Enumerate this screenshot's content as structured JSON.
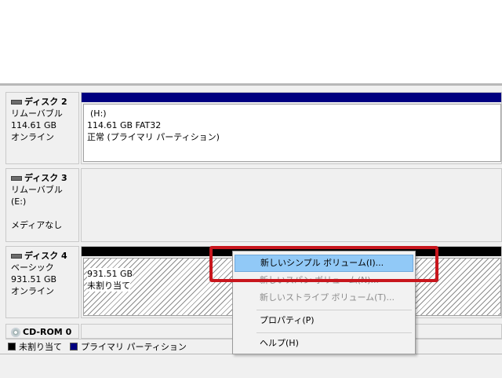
{
  "disks": [
    {
      "name": "ディスク 2",
      "type": "リムーバブル",
      "size": "114.61 GB",
      "status": "オンライン",
      "volume": {
        "letter": "(H:)",
        "size_fs": "114.61 GB FAT32",
        "state": "正常 (プライマリ パーティション)",
        "bar_color": "#000080"
      }
    },
    {
      "name": "ディスク 3",
      "type": "リムーバブル (E:)",
      "media": "メディアなし"
    },
    {
      "name": "ディスク 4",
      "type": "ベーシック",
      "size": "931.51 GB",
      "status": "オンライン",
      "volume": {
        "size": "931.51 GB",
        "state": "未割り当て",
        "bar_color": "#000000"
      }
    },
    {
      "name": "CD-ROM 0"
    }
  ],
  "legend": [
    {
      "label": "未割り当て",
      "color": "#000000"
    },
    {
      "label": "プライマリ パーティション",
      "color": "#000080"
    }
  ],
  "context_menu": {
    "items": [
      {
        "label": "新しいシンプル ボリューム(I)...",
        "enabled": true,
        "highlighted": true
      },
      {
        "label": "新しいスパン ボリューム(N)...",
        "enabled": false
      },
      {
        "label": "新しいストライプ ボリューム(T)...",
        "enabled": false
      },
      {
        "label": "プロパティ(P)",
        "enabled": true
      },
      {
        "label": "ヘルプ(H)",
        "enabled": true
      }
    ]
  },
  "colors": {
    "annotation_box": "#c8161d",
    "menu_highlight": "#91c9f7"
  }
}
